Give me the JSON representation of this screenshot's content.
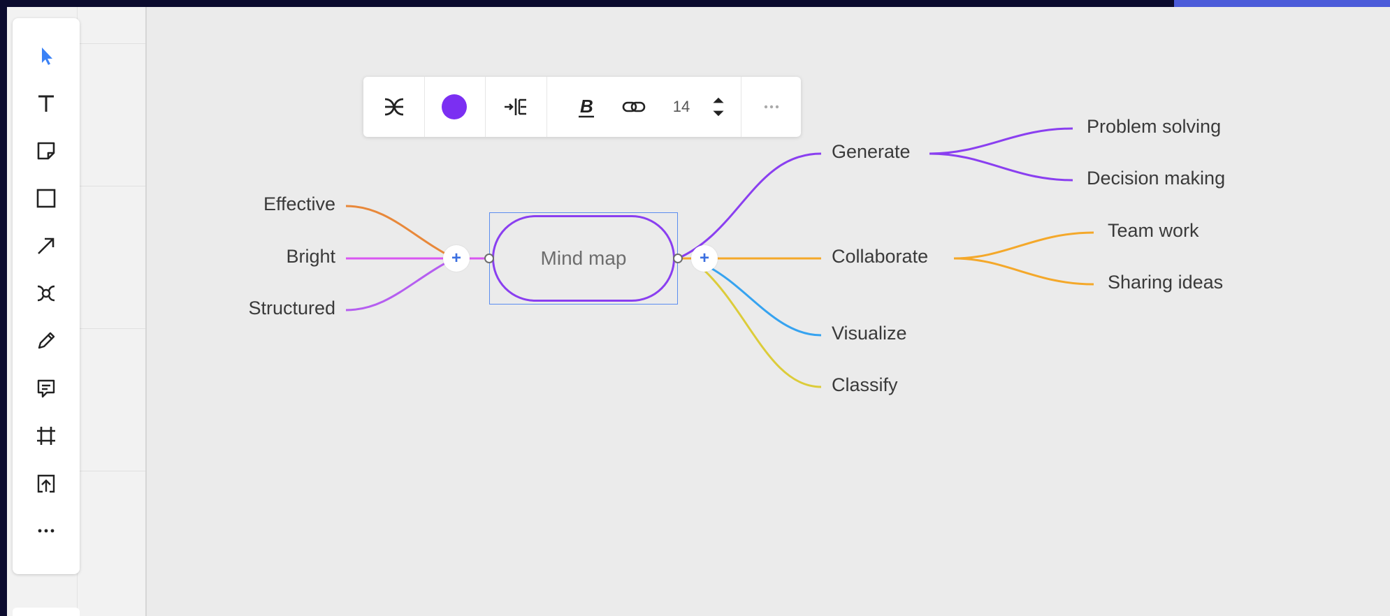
{
  "toolbar": {
    "tools": [
      {
        "name": "select-tool",
        "icon": "cursor-arrow-icon"
      },
      {
        "name": "text-tool",
        "icon": "text-icon"
      },
      {
        "name": "sticky-note-tool",
        "icon": "sticky-note-icon"
      },
      {
        "name": "shape-tool",
        "icon": "square-icon"
      },
      {
        "name": "connection-line-tool",
        "icon": "arrow-icon"
      },
      {
        "name": "mind-map-tool",
        "icon": "mind-map-icon"
      },
      {
        "name": "pen-tool",
        "icon": "pen-icon"
      },
      {
        "name": "comment-tool",
        "icon": "comment-icon"
      },
      {
        "name": "frame-tool",
        "icon": "frame-icon"
      },
      {
        "name": "upload-tool",
        "icon": "upload-icon"
      },
      {
        "name": "more-tools",
        "icon": "more-horizontal-icon"
      }
    ],
    "active_color": "#3b82f6"
  },
  "context_toolbar": {
    "node_color": "#7b2ff2",
    "font_size": "14",
    "more_icon": "more-horizontal-icon"
  },
  "mind_map": {
    "center": "Mind map",
    "left": [
      {
        "label": "Effective",
        "color": "#e8883a"
      },
      {
        "label": "Bright",
        "color": "#d957f2"
      },
      {
        "label": "Structured",
        "color": "#b55ef0"
      }
    ],
    "right": [
      {
        "label": "Generate",
        "color": "#8a3ff0",
        "children": [
          "Problem solving",
          "Decision making"
        ]
      },
      {
        "label": "Collaborate",
        "color": "#f4a82a",
        "children": [
          "Team work",
          "Sharing ideas"
        ]
      },
      {
        "label": "Visualize",
        "color": "#36a3f0",
        "children": []
      },
      {
        "label": "Classify",
        "color": "#dccc3a",
        "children": []
      }
    ]
  },
  "selection_color": "#5b8df0"
}
